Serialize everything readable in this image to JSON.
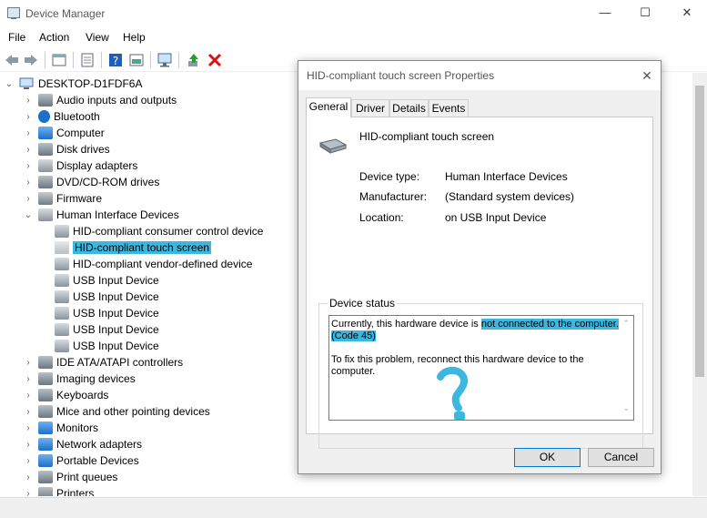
{
  "window": {
    "title": "Device Manager",
    "min": "—",
    "max": "☐",
    "close": "✕"
  },
  "menu": [
    "File",
    "Action",
    "View",
    "Help"
  ],
  "tree": {
    "root": "DESKTOP-D1FDF6A",
    "items": [
      {
        "label": "Audio inputs and outputs",
        "icon": "speaker-icon",
        "state": "collapsed"
      },
      {
        "label": "Bluetooth",
        "icon": "bluetooth-icon",
        "state": "collapsed"
      },
      {
        "label": "Computer",
        "icon": "computer-icon",
        "state": "collapsed"
      },
      {
        "label": "Disk drives",
        "icon": "disk-drive-icon",
        "state": "collapsed"
      },
      {
        "label": "Display adapters",
        "icon": "display-adapter-icon",
        "state": "collapsed"
      },
      {
        "label": "DVD/CD-ROM drives",
        "icon": "dvd-drive-icon",
        "state": "collapsed"
      },
      {
        "label": "Firmware",
        "icon": "firmware-icon",
        "state": "collapsed"
      },
      {
        "label": "Human Interface Devices",
        "icon": "hid-icon",
        "state": "expanded"
      }
    ],
    "hid_children": [
      {
        "label": "HID-compliant consumer control device"
      },
      {
        "label": "HID-compliant touch screen",
        "selected": true
      },
      {
        "label": "HID-compliant vendor-defined device"
      },
      {
        "label": "USB Input Device"
      },
      {
        "label": "USB Input Device"
      },
      {
        "label": "USB Input Device"
      },
      {
        "label": "USB Input Device"
      },
      {
        "label": "USB Input Device"
      }
    ],
    "items_after": [
      {
        "label": "IDE ATA/ATAPI controllers",
        "icon": "ide-controller-icon"
      },
      {
        "label": "Imaging devices",
        "icon": "camera-icon"
      },
      {
        "label": "Keyboards",
        "icon": "keyboard-icon"
      },
      {
        "label": "Mice and other pointing devices",
        "icon": "mouse-icon"
      },
      {
        "label": "Monitors",
        "icon": "monitor-icon"
      },
      {
        "label": "Network adapters",
        "icon": "network-adapter-icon"
      },
      {
        "label": "Portable Devices",
        "icon": "portable-device-icon"
      },
      {
        "label": "Print queues",
        "icon": "printer-icon"
      },
      {
        "label": "Printers",
        "icon": "printer-icon"
      }
    ]
  },
  "dialog": {
    "title": "HID-compliant touch screen Properties",
    "close": "✕",
    "tabs": [
      "General",
      "Driver",
      "Details",
      "Events"
    ],
    "device_name": "HID-compliant touch screen",
    "props": [
      {
        "label": "Device type:",
        "value": "Human Interface Devices"
      },
      {
        "label": "Manufacturer:",
        "value": "(Standard system devices)"
      },
      {
        "label": "Location:",
        "value": "on USB Input Device"
      }
    ],
    "status_group": "Device status",
    "status_line1_pre": "Currently, this hardware device is ",
    "status_line1_hl": "not connected to the computer.",
    "status_line2_hl": "(Code 45)",
    "status_fix": "To fix this problem, reconnect this hardware device to the computer.",
    "annotation": "?",
    "ok": "OK",
    "cancel": "Cancel"
  },
  "colors": {
    "highlight": "#3cb8e0",
    "accent": "#0078d7"
  }
}
